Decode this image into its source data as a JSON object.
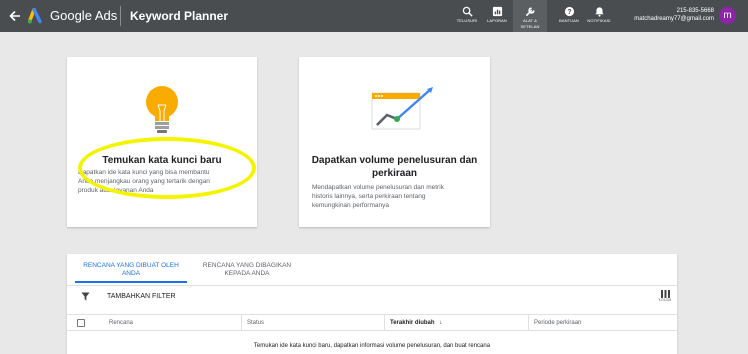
{
  "header": {
    "brand": "Google Ads",
    "title": "Keyword Planner",
    "tools": [
      {
        "label": "TELUSURI",
        "icon": "search-icon"
      },
      {
        "label": "LAPORAN",
        "icon": "reports-icon"
      },
      {
        "label": "ALAT & SETELAN",
        "icon": "wrench-icon",
        "active": true
      },
      {
        "label": "BANTUAN",
        "icon": "help-icon"
      },
      {
        "label": "NOTIFIKASI",
        "icon": "bell-icon"
      }
    ],
    "account": {
      "phone": "215-835-5668",
      "email": "matchadreamy77@gmail.com",
      "avatar_letter": "m",
      "avatar_color": "#8e24aa"
    }
  },
  "cards": {
    "discover": {
      "title": "Temukan kata kunci baru",
      "desc_lines": [
        "Dapatkan ide kata kunci yang bisa membantu",
        "Anda menjangkau orang yang tertarik dengan",
        "produk atau layanan Anda"
      ]
    },
    "forecast": {
      "title_lines": [
        "Dapatkan volume penelusuran dan",
        "perkiraan"
      ],
      "desc_lines": [
        "Mendapatkan volume penelusuran dan metrik",
        "historis lainnya, serta perkiraan tentang",
        "kemungkinan performanya"
      ]
    }
  },
  "plans": {
    "tabs": [
      {
        "lines": [
          "RENCANA YANG DIBUAT OLEH",
          "ANDA"
        ],
        "active": true
      },
      {
        "lines": [
          "RENCANA YANG DIBAGIKAN",
          "KEPADA ANDA"
        ],
        "active": false
      }
    ],
    "filter_label": "TAMBAHKAN FILTER",
    "columns_label": "KOLOM",
    "table_headers": {
      "plan": "Rencana",
      "status": "Status",
      "modified": "Terakhir diubah",
      "sort_arrow": "↓",
      "period": "Periode perkiraan"
    },
    "empty_message": "Temukan ide kata kunci baru, dapatkan informasi volume penelusuran, dan buat rencana"
  },
  "colors": {
    "accent": "#1a73e8",
    "topbar": "#4a4d50",
    "highlight": "#f4f400",
    "bulb": "#f9ab00"
  }
}
